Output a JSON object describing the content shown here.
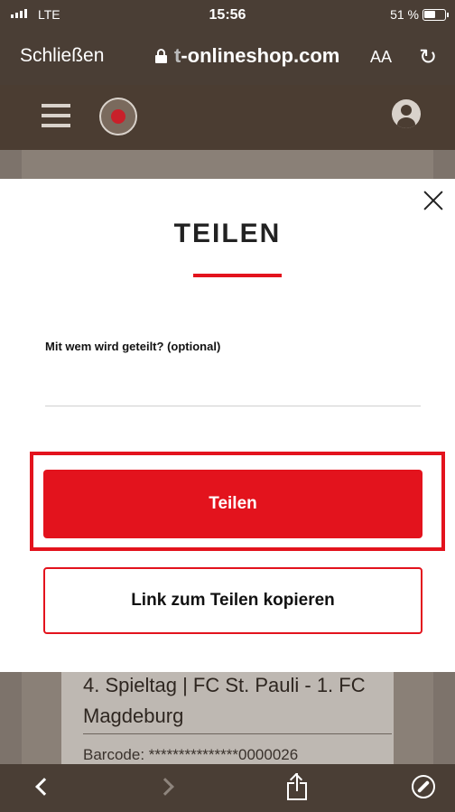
{
  "status_bar": {
    "carrier": "LTE",
    "time": "15:56",
    "battery": "51 %"
  },
  "browser": {
    "close_label": "Schließen",
    "url_prefix": "t",
    "url_host": "-onlineshop.com",
    "text_size_label": "AA",
    "reload_icon": "reload-icon"
  },
  "site_header": {
    "menu_icon": "hamburger-icon",
    "logo": "fc-st-pauli-logo",
    "account_icon": "user-icon"
  },
  "background_page": {
    "event_title": "4. Spieltag | FC St. Pauli - 1. FC Magdeburg",
    "barcode": "Barcode: ***************0000026"
  },
  "modal": {
    "title": "TEILEN",
    "field_label": "Mit wem wird geteilt? (optional)",
    "field_value": "",
    "share_button": "Teilen",
    "copy_link_button": "Link zum Teilen kopieren",
    "accent_color": "#e3131d"
  },
  "toolbar": {
    "back_icon": "chevron-left-icon",
    "forward_icon": "chevron-right-icon",
    "share_icon": "share-icon",
    "safari_icon": "compass-icon"
  }
}
